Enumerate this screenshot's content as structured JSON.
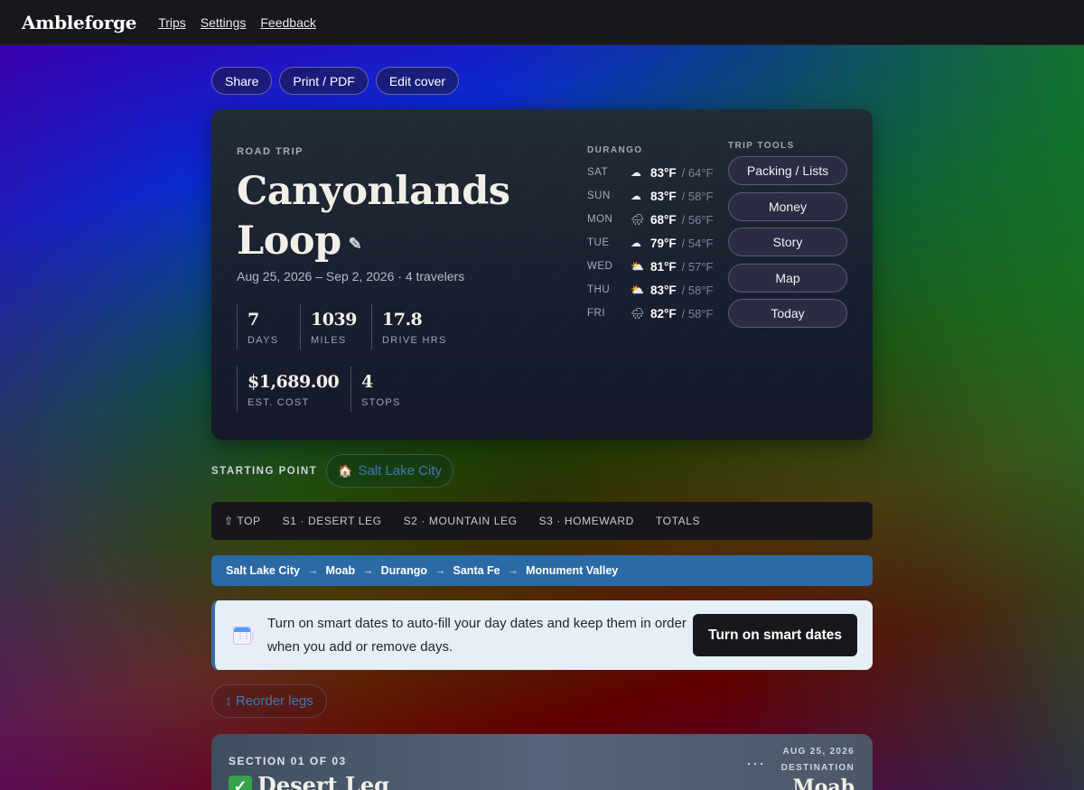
{
  "app": {
    "brand": "Ambleforge",
    "nav": [
      "Trips",
      "Settings",
      "Feedback"
    ]
  },
  "actions": [
    "Share",
    "Print / PDF",
    "Edit cover"
  ],
  "hero": {
    "kicker": "ROAD TRIP",
    "title": "Canyonlands Loop",
    "subline": "Aug 25, 2026 – Sep 2, 2026 · 4 travelers",
    "stats": [
      {
        "value": "7",
        "label": "DAYS"
      },
      {
        "value": "1039",
        "label": "MILES"
      },
      {
        "value": "17.8",
        "label": "DRIVE HRS"
      },
      {
        "value": "$1,689.00",
        "label": "EST. COST"
      },
      {
        "value": "4",
        "label": "STOPS"
      }
    ]
  },
  "weather": {
    "city": "DURANGO",
    "days": [
      {
        "day": "SAT",
        "icon": "cloud-icon",
        "glyph": "☁",
        "hi": "83°F",
        "lo": "/ 64°F"
      },
      {
        "day": "SUN",
        "icon": "cloud-icon",
        "glyph": "☁",
        "hi": "83°F",
        "lo": "/ 58°F"
      },
      {
        "day": "MON",
        "icon": "rain-cloud-icon",
        "glyph": "🌧",
        "hi": "68°F",
        "lo": "/ 56°F"
      },
      {
        "day": "TUE",
        "icon": "cloud-icon",
        "glyph": "☁",
        "hi": "79°F",
        "lo": "/ 54°F"
      },
      {
        "day": "WED",
        "icon": "partly-sunny-icon",
        "glyph": "⛅",
        "hi": "81°F",
        "lo": "/ 57°F"
      },
      {
        "day": "THU",
        "icon": "partly-sunny-icon",
        "glyph": "⛅",
        "hi": "83°F",
        "lo": "/ 58°F"
      },
      {
        "day": "FRI",
        "icon": "rain-cloud-icon",
        "glyph": "🌧",
        "hi": "82°F",
        "lo": "/ 58°F"
      }
    ]
  },
  "tools": {
    "heading": "TRIP TOOLS",
    "items": [
      "Packing / Lists",
      "Money",
      "Story",
      "Map",
      "Today"
    ]
  },
  "start": {
    "label": "STARTING POINT",
    "icon": "house-icon",
    "glyph": "🏠",
    "city": "Salt Lake City"
  },
  "sectionNav": [
    "⇧ TOP",
    "S1 · DESERT LEG",
    "S2 · MOUNTAIN LEG",
    "S3 · HOMEWARD",
    "TOTALS"
  ],
  "route": [
    "Salt Lake City",
    "Moab",
    "Durango",
    "Santa Fe",
    "Monument Valley"
  ],
  "routeArrow": "→",
  "banner": {
    "icon": "calendar-icon",
    "text": "Turn on smart dates to auto-fill your day dates and keep them in order when you add or remove days.",
    "button": "Turn on smart dates"
  },
  "reorder": "↕ Reorder legs",
  "section": {
    "kicker": "SECTION 01 OF 03",
    "check": "✓",
    "title": "Desert Leg",
    "more": "···",
    "date": "AUG 25, 2026",
    "destLabel": "DESTINATION",
    "destName": "Moab"
  },
  "colors": {
    "accent": "#2c6aa6",
    "link": "#3f78b4",
    "topbar": "#17171c"
  }
}
